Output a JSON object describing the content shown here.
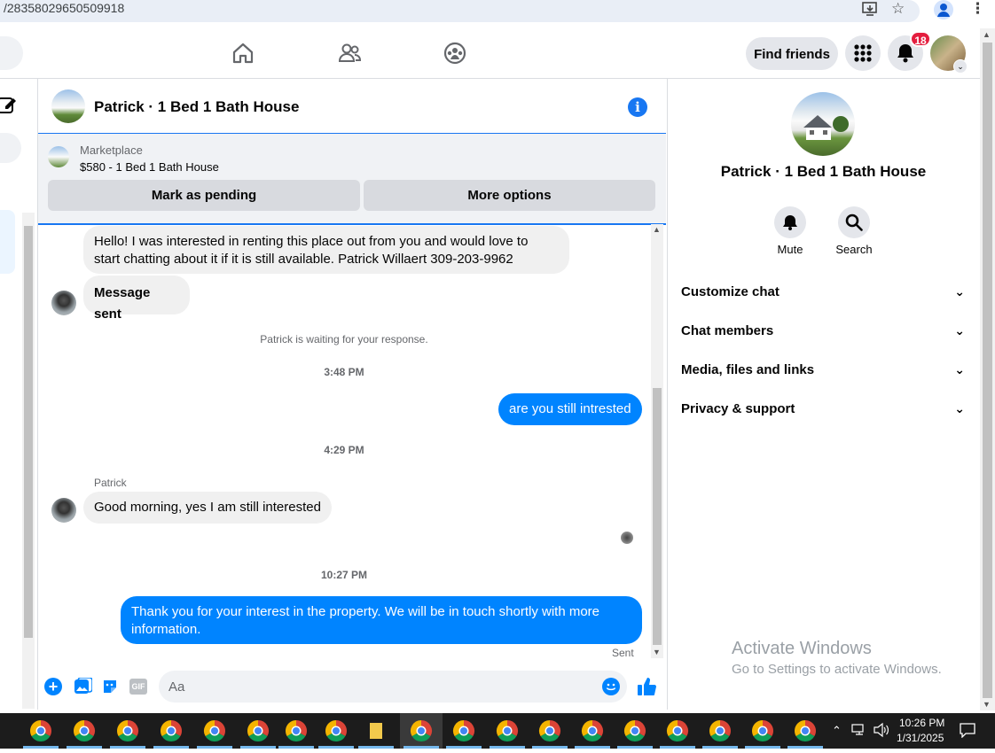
{
  "browser": {
    "url_text": "/28358029650509918"
  },
  "nav": {
    "find_friends": "Find friends",
    "notification_count": "18",
    "icons": [
      "home-icon",
      "friends-icon",
      "groups-icon",
      "apps-grid-icon",
      "bell-icon"
    ]
  },
  "chat": {
    "title": "Patrick · 1 Bed 1 Bath House",
    "marketplace_label": "Marketplace",
    "listing": "$580 - 1 Bed 1 Bath House",
    "mark_pending": "Mark as pending",
    "more_options": "More options",
    "messages": {
      "m1_line1": "Hello! I was interested in renting this place out from you and would love to",
      "m1_line2": "start chatting about it if it is still available. Patrick Willaert 309-203-9962",
      "m2": "Message sent",
      "waiting": "Patrick is waiting for your response.",
      "t1": "3:48 PM",
      "m3": "are you still intrested",
      "t2": "4:29 PM",
      "sender": "Patrick",
      "m4": "Good morning, yes I am still interested",
      "t3": "10:27 PM",
      "m5_line1": "Thank you for your interest in the property. We will be in touch shortly with more",
      "m5_line2": "information.",
      "sent": "Sent"
    },
    "composer_placeholder": "Aa"
  },
  "right_panel": {
    "title": "Patrick · 1 Bed 1 Bath House",
    "mute": "Mute",
    "search": "Search",
    "sections": [
      "Customize chat",
      "Chat members",
      "Media, files and links",
      "Privacy & support"
    ]
  },
  "watermark": {
    "line1": "Activate Windows",
    "line2": "Go to Settings to activate Windows."
  },
  "taskbar": {
    "time": "10:26 PM",
    "date": "1/31/2025"
  },
  "colors": {
    "messenger_blue": "#0084ff",
    "fb_blue": "#1877f2",
    "badge_red": "#e41e3f"
  }
}
